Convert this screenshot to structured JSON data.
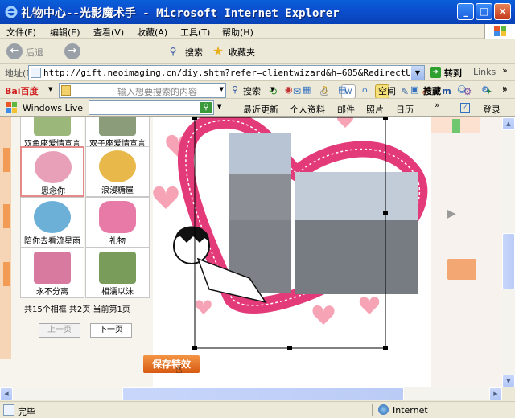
{
  "window": {
    "title": "礼物中心--光影魔术手 - Microsoft Internet Explorer"
  },
  "menu": [
    "文件(F)",
    "编辑(E)",
    "查看(V)",
    "收藏(A)",
    "工具(T)",
    "帮助(H)"
  ],
  "toolbar": {
    "back": "后退",
    "search": "搜索",
    "favorites": "收藏夹"
  },
  "address": {
    "label": "地址(D)",
    "url": "http://gift.neoimaging.cn/diy.shtm?refer=clientwizard&h=605&RedirectUrl=htt",
    "go": "转到",
    "links": "Links"
  },
  "baidu": {
    "brand": "Bai百度",
    "placeholder": "输入想要搜索的内容",
    "search": "搜索",
    "space": "空间",
    "hide": "搜藏"
  },
  "live": {
    "brand": "Windows Live",
    "items": [
      "最近更新",
      "个人资料",
      "邮件",
      "照片",
      "日历"
    ],
    "login": "登录"
  },
  "frames": [
    {
      "caption": "双鱼座爱情宣言",
      "color": "#9BB87A"
    },
    {
      "caption": "双子座爱情宣言",
      "color": "#8A9C7A"
    },
    {
      "caption": "思念你",
      "color": "#E8A0B8",
      "selected": true
    },
    {
      "caption": "浪漫糖屋",
      "color": "#E8B84A"
    },
    {
      "caption": "陪你去看流星雨",
      "color": "#6CB0D8"
    },
    {
      "caption": "礼物",
      "color": "#E87AA8"
    },
    {
      "caption": "永不分离",
      "color": "#D87AA0"
    },
    {
      "caption": "相濡以沫",
      "color": "#7A9C5A"
    }
  ],
  "paging": {
    "info": "共15个相框 共2页 当前第1页",
    "prev": "上一页",
    "next": "下一页"
  },
  "save_button": "保存特效",
  "status": {
    "text": "完毕",
    "zone": "Internet"
  }
}
